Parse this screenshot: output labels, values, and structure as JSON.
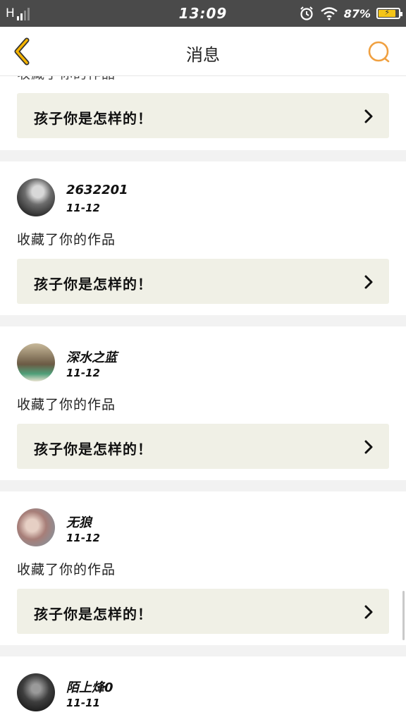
{
  "status_bar": {
    "network": "H",
    "time": "13:09",
    "battery_percent": "87%",
    "battery_level": 0.87,
    "icons": [
      "signal-icon",
      "alarm-icon",
      "wifi-icon",
      "battery-icon"
    ]
  },
  "header": {
    "title": "消息",
    "back_icon": "chevron-left-icon",
    "search_icon": "search-icon"
  },
  "colors": {
    "accent": "#f5b400",
    "work_box_bg": "#f0f0e6",
    "status_bar_bg": "#4a4a4a",
    "search_ring": "#f0a040"
  },
  "messages": [
    {
      "username": "",
      "date": "",
      "action": "收藏了你的作品",
      "work_title": "孩子你是怎样的！"
    },
    {
      "username": "2632201",
      "date": "11-12",
      "action": "收藏了你的作品",
      "work_title": "孩子你是怎样的！"
    },
    {
      "username": "深水之蓝",
      "date": "11-12",
      "action": "收藏了你的作品",
      "work_title": "孩子你是怎样的！"
    },
    {
      "username": "无狼",
      "date": "11-12",
      "action": "收藏了你的作品",
      "work_title": "孩子你是怎样的！"
    },
    {
      "username": "陌上烽0",
      "date": "11-11",
      "action": "",
      "work_title": ""
    }
  ]
}
